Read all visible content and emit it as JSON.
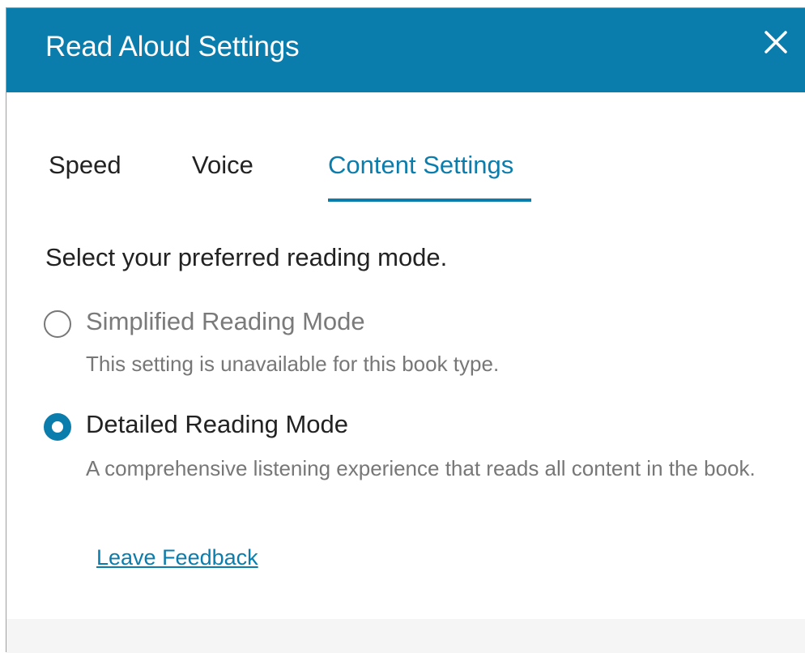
{
  "dialog": {
    "title": "Read Aloud Settings",
    "close_icon": "close-icon"
  },
  "tabs": [
    {
      "label": "Speed",
      "active": false
    },
    {
      "label": "Voice",
      "active": false
    },
    {
      "label": "Content Settings",
      "active": true
    }
  ],
  "content": {
    "prompt": "Select your preferred reading mode.",
    "options": [
      {
        "label": "Simplified Reading Mode",
        "description": "This setting is unavailable for this book type.",
        "selected": false,
        "disabled": true
      },
      {
        "label": "Detailed Reading Mode",
        "description": "A comprehensive listening experience that reads all content in the book.",
        "selected": true,
        "disabled": false
      }
    ],
    "feedback_link": "Leave Feedback"
  },
  "colors": {
    "accent": "#0b7dad",
    "text": "#222222",
    "muted": "#777777"
  }
}
